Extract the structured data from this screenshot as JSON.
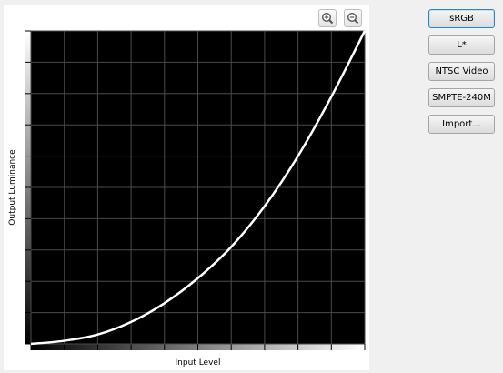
{
  "graph": {
    "y_axis_label": "Output Luminance",
    "x_axis_label": "Input Level",
    "zoom_in_icon": "zoom-in-icon",
    "zoom_out_icon": "zoom-out-icon",
    "colors": {
      "plot_background": "#000000",
      "grid": "#4a4a4a",
      "curve": "#ffffff"
    }
  },
  "presets": [
    {
      "label": "sRGB",
      "focused": true
    },
    {
      "label": "L*"
    },
    {
      "label": "NTSC Video"
    },
    {
      "label": "SMPTE-240M"
    },
    {
      "label": "Import..."
    }
  ],
  "chart_data": {
    "type": "line",
    "xlim": [
      0,
      1
    ],
    "ylim": [
      0,
      1
    ],
    "grid": true,
    "series": [
      {
        "x": [
          0,
          0.1,
          0.2,
          0.3,
          0.4,
          0.5,
          0.6,
          0.7,
          0.8,
          0.9,
          1.0
        ],
        "y": [
          0,
          0.01,
          0.03,
          0.07,
          0.13,
          0.21,
          0.31,
          0.44,
          0.6,
          0.79,
          1.0
        ]
      }
    ]
  }
}
